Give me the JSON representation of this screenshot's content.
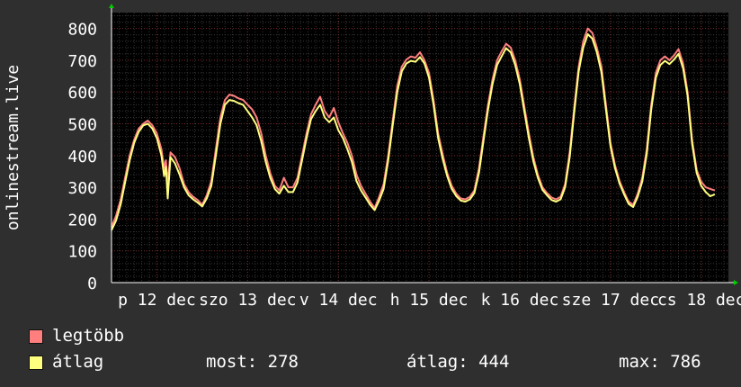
{
  "chart_data": {
    "type": "line",
    "ylabel": "onlinestream.live",
    "ylim": [
      0,
      850
    ],
    "yticks": [
      0,
      100,
      200,
      300,
      400,
      500,
      600,
      700,
      800
    ],
    "xtick_labels": [
      "p 12 dec",
      "szo 13 dec",
      "v 14 dec",
      "h 15 dec",
      "k 16 dec",
      "sze 17 dec",
      "cs 18 dec"
    ],
    "x_days": [
      12,
      13,
      14,
      15,
      16,
      17,
      18
    ],
    "grid": true,
    "series": [
      {
        "name": "legtöbb",
        "color": "#ff7f7f",
        "points": [
          [
            11.5,
            175
          ],
          [
            11.55,
            210
          ],
          [
            11.6,
            260
          ],
          [
            11.65,
            330
          ],
          [
            11.7,
            400
          ],
          [
            11.75,
            450
          ],
          [
            11.8,
            485
          ],
          [
            11.85,
            500
          ],
          [
            11.9,
            510
          ],
          [
            11.95,
            495
          ],
          [
            12.0,
            470
          ],
          [
            12.05,
            420
          ],
          [
            12.08,
            360
          ],
          [
            12.1,
            385
          ],
          [
            12.12,
            310
          ],
          [
            12.15,
            410
          ],
          [
            12.2,
            395
          ],
          [
            12.25,
            360
          ],
          [
            12.3,
            310
          ],
          [
            12.35,
            285
          ],
          [
            12.4,
            270
          ],
          [
            12.45,
            260
          ],
          [
            12.5,
            245
          ],
          [
            12.55,
            275
          ],
          [
            12.6,
            320
          ],
          [
            12.65,
            420
          ],
          [
            12.7,
            520
          ],
          [
            12.75,
            575
          ],
          [
            12.8,
            592
          ],
          [
            12.85,
            588
          ],
          [
            12.9,
            580
          ],
          [
            12.95,
            575
          ],
          [
            13.0,
            560
          ],
          [
            13.05,
            545
          ],
          [
            13.1,
            520
          ],
          [
            13.15,
            470
          ],
          [
            13.2,
            400
          ],
          [
            13.25,
            345
          ],
          [
            13.3,
            305
          ],
          [
            13.35,
            290
          ],
          [
            13.4,
            330
          ],
          [
            13.45,
            300
          ],
          [
            13.5,
            300
          ],
          [
            13.55,
            330
          ],
          [
            13.6,
            400
          ],
          [
            13.65,
            470
          ],
          [
            13.7,
            530
          ],
          [
            13.75,
            560
          ],
          [
            13.8,
            585
          ],
          [
            13.85,
            540
          ],
          [
            13.9,
            520
          ],
          [
            13.95,
            550
          ],
          [
            14.0,
            505
          ],
          [
            14.05,
            470
          ],
          [
            14.1,
            440
          ],
          [
            14.15,
            400
          ],
          [
            14.2,
            340
          ],
          [
            14.25,
            305
          ],
          [
            14.3,
            280
          ],
          [
            14.35,
            255
          ],
          [
            14.4,
            235
          ],
          [
            14.45,
            270
          ],
          [
            14.5,
            310
          ],
          [
            14.55,
            400
          ],
          [
            14.6,
            510
          ],
          [
            14.65,
            620
          ],
          [
            14.7,
            680
          ],
          [
            14.75,
            702
          ],
          [
            14.8,
            712
          ],
          [
            14.85,
            708
          ],
          [
            14.9,
            725
          ],
          [
            14.95,
            700
          ],
          [
            15.0,
            660
          ],
          [
            15.05,
            575
          ],
          [
            15.1,
            470
          ],
          [
            15.15,
            405
          ],
          [
            15.2,
            345
          ],
          [
            15.25,
            305
          ],
          [
            15.3,
            280
          ],
          [
            15.35,
            265
          ],
          [
            15.4,
            262
          ],
          [
            15.45,
            270
          ],
          [
            15.5,
            290
          ],
          [
            15.55,
            360
          ],
          [
            15.6,
            460
          ],
          [
            15.65,
            560
          ],
          [
            15.7,
            640
          ],
          [
            15.75,
            700
          ],
          [
            15.8,
            728
          ],
          [
            15.85,
            752
          ],
          [
            15.9,
            740
          ],
          [
            15.95,
            700
          ],
          [
            16.0,
            640
          ],
          [
            16.05,
            555
          ],
          [
            16.1,
            470
          ],
          [
            16.15,
            395
          ],
          [
            16.2,
            340
          ],
          [
            16.25,
            300
          ],
          [
            16.3,
            282
          ],
          [
            16.35,
            268
          ],
          [
            16.4,
            262
          ],
          [
            16.45,
            270
          ],
          [
            16.5,
            310
          ],
          [
            16.55,
            410
          ],
          [
            16.6,
            550
          ],
          [
            16.65,
            680
          ],
          [
            16.7,
            760
          ],
          [
            16.75,
            800
          ],
          [
            16.8,
            786
          ],
          [
            16.85,
            740
          ],
          [
            16.9,
            680
          ],
          [
            16.95,
            560
          ],
          [
            17.0,
            440
          ],
          [
            17.05,
            370
          ],
          [
            17.1,
            320
          ],
          [
            17.15,
            285
          ],
          [
            17.2,
            255
          ],
          [
            17.25,
            245
          ],
          [
            17.3,
            280
          ],
          [
            17.35,
            330
          ],
          [
            17.4,
            420
          ],
          [
            17.45,
            560
          ],
          [
            17.5,
            660
          ],
          [
            17.55,
            700
          ],
          [
            17.6,
            712
          ],
          [
            17.65,
            700
          ],
          [
            17.7,
            715
          ],
          [
            17.75,
            735
          ],
          [
            17.8,
            690
          ],
          [
            17.85,
            600
          ],
          [
            17.9,
            450
          ],
          [
            17.95,
            355
          ],
          [
            18.0,
            318
          ],
          [
            18.05,
            300
          ],
          [
            18.1,
            295
          ],
          [
            18.15,
            290
          ]
        ]
      },
      {
        "name": "átlag",
        "color": "#ffff7f",
        "points": [
          [
            11.5,
            165
          ],
          [
            11.55,
            195
          ],
          [
            11.6,
            245
          ],
          [
            11.65,
            315
          ],
          [
            11.7,
            385
          ],
          [
            11.75,
            440
          ],
          [
            11.8,
            475
          ],
          [
            11.85,
            495
          ],
          [
            11.9,
            500
          ],
          [
            11.95,
            485
          ],
          [
            12.0,
            455
          ],
          [
            12.05,
            400
          ],
          [
            12.08,
            335
          ],
          [
            12.1,
            365
          ],
          [
            12.12,
            265
          ],
          [
            12.15,
            395
          ],
          [
            12.2,
            375
          ],
          [
            12.25,
            340
          ],
          [
            12.3,
            300
          ],
          [
            12.35,
            275
          ],
          [
            12.4,
            262
          ],
          [
            12.45,
            252
          ],
          [
            12.5,
            240
          ],
          [
            12.55,
            265
          ],
          [
            12.6,
            305
          ],
          [
            12.65,
            400
          ],
          [
            12.7,
            500
          ],
          [
            12.75,
            560
          ],
          [
            12.8,
            575
          ],
          [
            12.85,
            572
          ],
          [
            12.9,
            565
          ],
          [
            12.95,
            560
          ],
          [
            13.0,
            540
          ],
          [
            13.05,
            520
          ],
          [
            13.1,
            495
          ],
          [
            13.15,
            445
          ],
          [
            13.2,
            380
          ],
          [
            13.25,
            330
          ],
          [
            13.3,
            295
          ],
          [
            13.35,
            280
          ],
          [
            13.4,
            305
          ],
          [
            13.45,
            285
          ],
          [
            13.5,
            285
          ],
          [
            13.55,
            315
          ],
          [
            13.6,
            385
          ],
          [
            13.65,
            455
          ],
          [
            13.7,
            515
          ],
          [
            13.75,
            540
          ],
          [
            13.8,
            560
          ],
          [
            13.85,
            520
          ],
          [
            13.9,
            505
          ],
          [
            13.95,
            520
          ],
          [
            14.0,
            480
          ],
          [
            14.05,
            455
          ],
          [
            14.1,
            420
          ],
          [
            14.15,
            380
          ],
          [
            14.2,
            320
          ],
          [
            14.25,
            290
          ],
          [
            14.3,
            268
          ],
          [
            14.35,
            245
          ],
          [
            14.4,
            228
          ],
          [
            14.45,
            258
          ],
          [
            14.5,
            295
          ],
          [
            14.55,
            385
          ],
          [
            14.6,
            495
          ],
          [
            14.65,
            600
          ],
          [
            14.7,
            665
          ],
          [
            14.75,
            690
          ],
          [
            14.8,
            698
          ],
          [
            14.85,
            695
          ],
          [
            14.9,
            710
          ],
          [
            14.95,
            690
          ],
          [
            15.0,
            645
          ],
          [
            15.05,
            560
          ],
          [
            15.1,
            455
          ],
          [
            15.15,
            390
          ],
          [
            15.2,
            335
          ],
          [
            15.25,
            295
          ],
          [
            15.3,
            272
          ],
          [
            15.35,
            258
          ],
          [
            15.4,
            255
          ],
          [
            15.45,
            262
          ],
          [
            15.5,
            282
          ],
          [
            15.55,
            345
          ],
          [
            15.6,
            445
          ],
          [
            15.65,
            545
          ],
          [
            15.7,
            625
          ],
          [
            15.75,
            685
          ],
          [
            15.8,
            712
          ],
          [
            15.85,
            738
          ],
          [
            15.9,
            725
          ],
          [
            15.95,
            685
          ],
          [
            16.0,
            625
          ],
          [
            16.05,
            540
          ],
          [
            16.1,
            455
          ],
          [
            16.15,
            382
          ],
          [
            16.2,
            330
          ],
          [
            16.25,
            292
          ],
          [
            16.3,
            275
          ],
          [
            16.35,
            260
          ],
          [
            16.4,
            255
          ],
          [
            16.45,
            262
          ],
          [
            16.5,
            300
          ],
          [
            16.55,
            395
          ],
          [
            16.6,
            535
          ],
          [
            16.65,
            665
          ],
          [
            16.7,
            740
          ],
          [
            16.75,
            782
          ],
          [
            16.8,
            768
          ],
          [
            16.85,
            725
          ],
          [
            16.9,
            662
          ],
          [
            16.95,
            545
          ],
          [
            17.0,
            428
          ],
          [
            17.05,
            360
          ],
          [
            17.1,
            312
          ],
          [
            17.15,
            278
          ],
          [
            17.2,
            248
          ],
          [
            17.25,
            238
          ],
          [
            17.3,
            270
          ],
          [
            17.35,
            318
          ],
          [
            17.4,
            405
          ],
          [
            17.45,
            545
          ],
          [
            17.5,
            645
          ],
          [
            17.55,
            685
          ],
          [
            17.6,
            698
          ],
          [
            17.65,
            688
          ],
          [
            17.7,
            702
          ],
          [
            17.75,
            720
          ],
          [
            17.8,
            675
          ],
          [
            17.85,
            588
          ],
          [
            17.9,
            438
          ],
          [
            17.95,
            345
          ],
          [
            18.0,
            305
          ],
          [
            18.05,
            285
          ],
          [
            18.1,
            272
          ],
          [
            18.15,
            278
          ]
        ]
      }
    ]
  },
  "legend": [
    {
      "label": "legtöbb",
      "color": "#ff7f7f"
    },
    {
      "label": "átlag",
      "color": "#ffff7f"
    }
  ],
  "stats": {
    "most": "most: 278",
    "atlag": "átlag: 444",
    "max": "max: 786"
  }
}
